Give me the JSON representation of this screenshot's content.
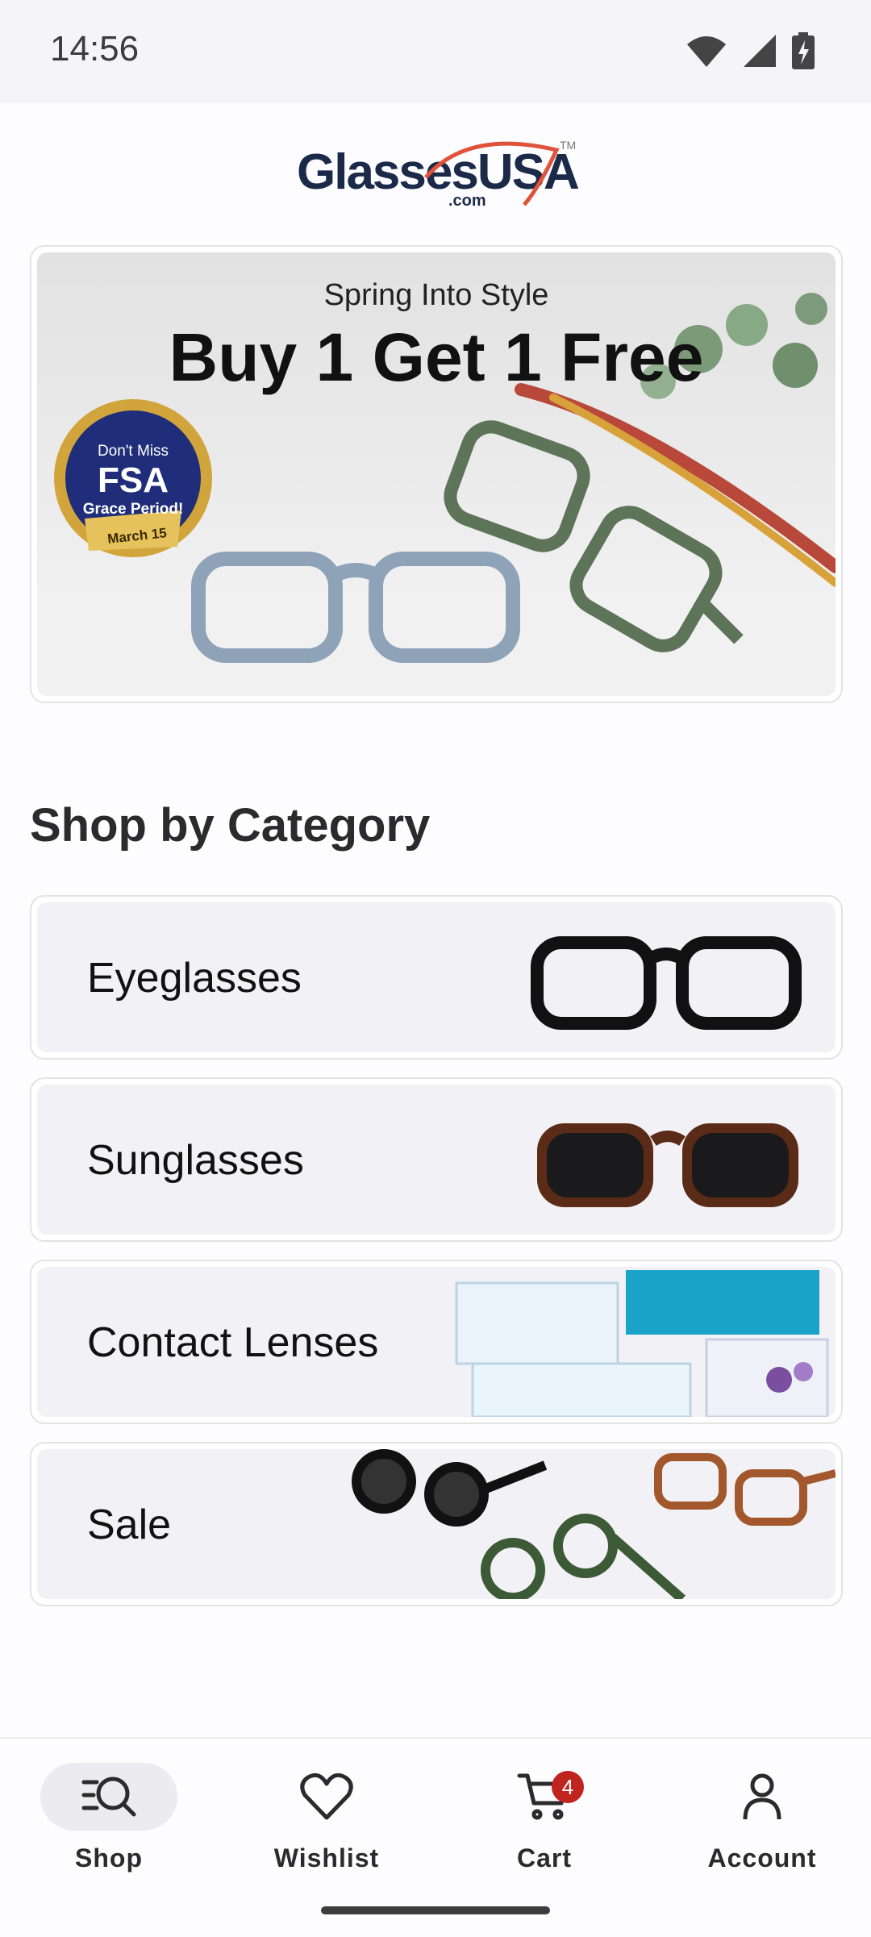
{
  "status_bar": {
    "time": "14:56"
  },
  "brand": {
    "logo_main": "Glasses",
    "logo_accent": "USA",
    "logo_sub": ".com",
    "logo_tm": "TM",
    "accent_color": "#e0533a"
  },
  "hero": {
    "subtitle": "Spring Into Style",
    "title": "Buy 1 Get 1 Free",
    "badge": {
      "line1": "Don't Miss",
      "line2": "FSA",
      "line3": "Grace Period!",
      "line4": "March 15"
    }
  },
  "shop_by_category": {
    "title": "Shop by Category",
    "items": [
      {
        "label": "Eyeglasses"
      },
      {
        "label": "Sunglasses"
      },
      {
        "label": "Contact Lenses"
      },
      {
        "label": "Sale"
      }
    ]
  },
  "bottom_nav": {
    "items": [
      {
        "label": "Shop",
        "icon": "shop-search-icon",
        "active": true
      },
      {
        "label": "Wishlist",
        "icon": "heart-icon"
      },
      {
        "label": "Cart",
        "icon": "cart-icon",
        "badge": "4"
      },
      {
        "label": "Account",
        "icon": "person-icon"
      }
    ]
  }
}
